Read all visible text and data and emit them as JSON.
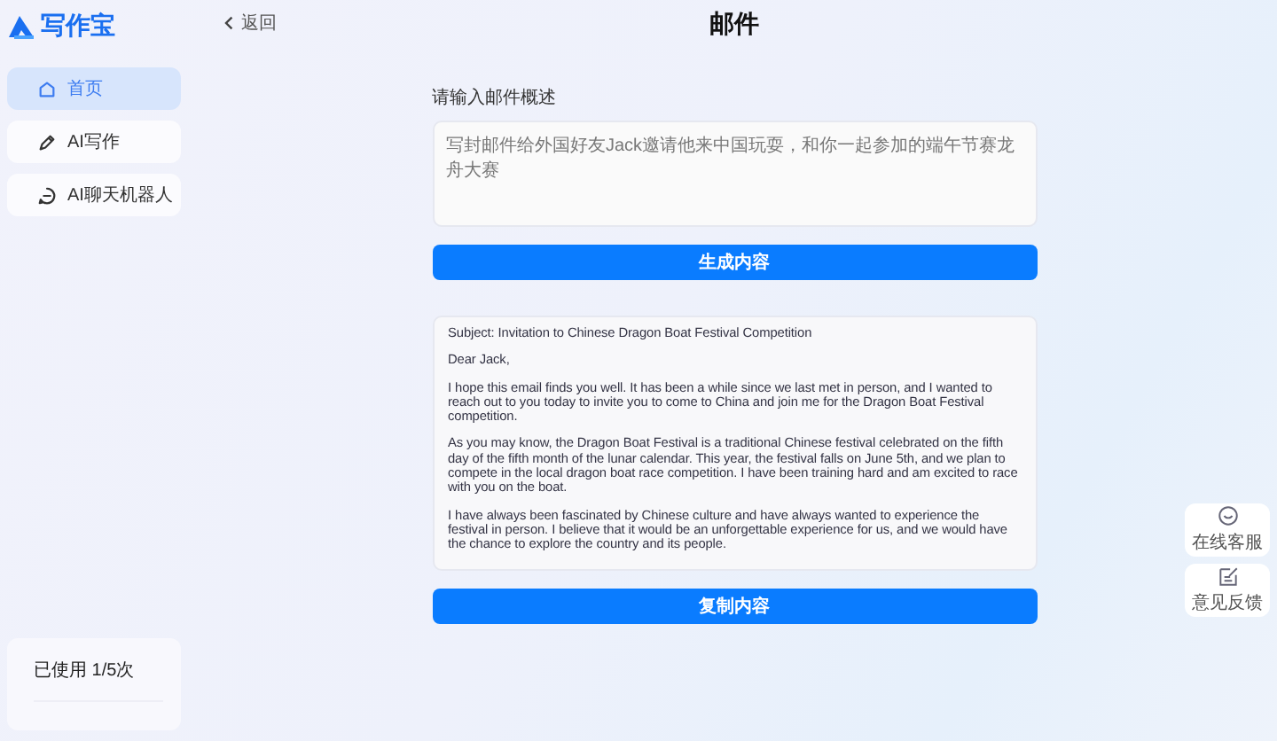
{
  "brand": {
    "name": "写作宝"
  },
  "sidebar": {
    "items": [
      {
        "label": "首页",
        "selected": true
      },
      {
        "label": "AI写作",
        "selected": false
      },
      {
        "label": "AI聊天机器人",
        "selected": false
      }
    ],
    "usage": "已使用 1/5次"
  },
  "header": {
    "back": "返回",
    "title": "邮件"
  },
  "form": {
    "label": "请输入邮件概述",
    "placeholder": "写封邮件给外国好友Jack邀请他来中国玩耍，和你一起参加的端午节赛龙舟大赛",
    "generate_button": "生成内容"
  },
  "result": {
    "paragraphs": [
      "Subject: Invitation to Chinese Dragon Boat Festival Competition",
      "Dear Jack,",
      "I hope this email finds you well. It has been a while since we last met in person, and I wanted to reach out to you today to invite you to come to China and join me for the Dragon Boat Festival competition.",
      "As you may know, the Dragon Boat Festival is a traditional Chinese festival celebrated on the fifth day of the fifth month of the lunar calendar. This year, the festival falls on June 5th, and we plan to compete in the local dragon boat race competition. I have been training hard and am excited to race with you on the boat.",
      "I have always been fascinated by Chinese culture and have always wanted to experience the festival in person. I believe that it would be an unforgettable experience for us, and we would have the chance to explore the country and its people."
    ],
    "copy_button": "复制内容"
  },
  "floating": [
    {
      "label": "在线客服"
    },
    {
      "label": "意见反馈"
    }
  ]
}
